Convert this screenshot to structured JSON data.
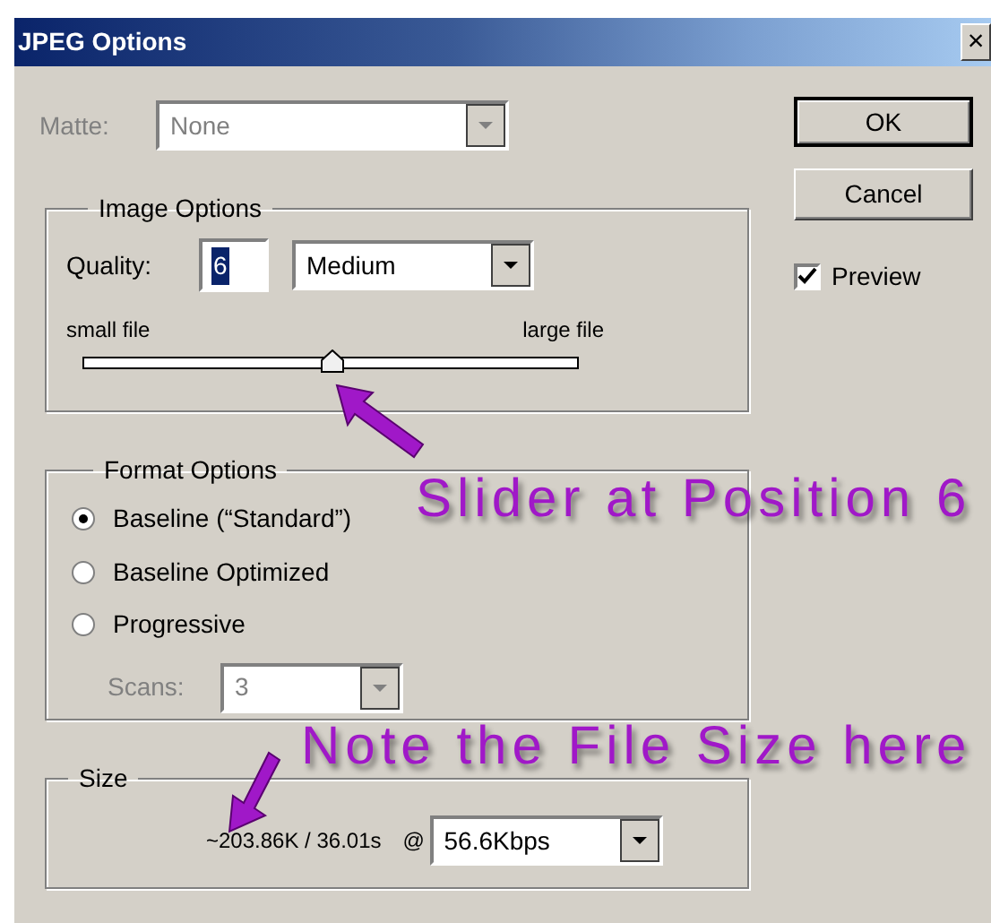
{
  "window": {
    "title": "JPEG Options",
    "close": "×"
  },
  "matte": {
    "label": "Matte:",
    "value": "None",
    "disabled": true
  },
  "image_options": {
    "title": "Image Options",
    "quality_label": "Quality:",
    "quality_value": "6",
    "quality_value_selected": true,
    "quality_preset": "Medium",
    "slider_min_label": "small file",
    "slider_max_label": "large file",
    "level": 0.5
  },
  "format_options": {
    "title": "Format Options",
    "options": [
      {
        "label": "Baseline (“Standard”)",
        "selected": true
      },
      {
        "label": "Baseline Optimized",
        "selected": false
      },
      {
        "label": "Progressive",
        "selected": false
      }
    ],
    "scans": {
      "label": "Scans:",
      "value": "3",
      "disabled": true
    }
  },
  "size": {
    "title": "Size",
    "estimate": "~203.86K / 36.01s",
    "at": "@",
    "speed": "56.6Kbps"
  },
  "buttons": [
    {
      "label": "OK",
      "default": true
    },
    {
      "label": "Cancel",
      "default": false
    }
  ],
  "preview": {
    "label": "Preview",
    "checked": true
  },
  "annotations": [
    {
      "text": "Slider at Position 6"
    },
    {
      "text": "Note the File Size here"
    }
  ]
}
